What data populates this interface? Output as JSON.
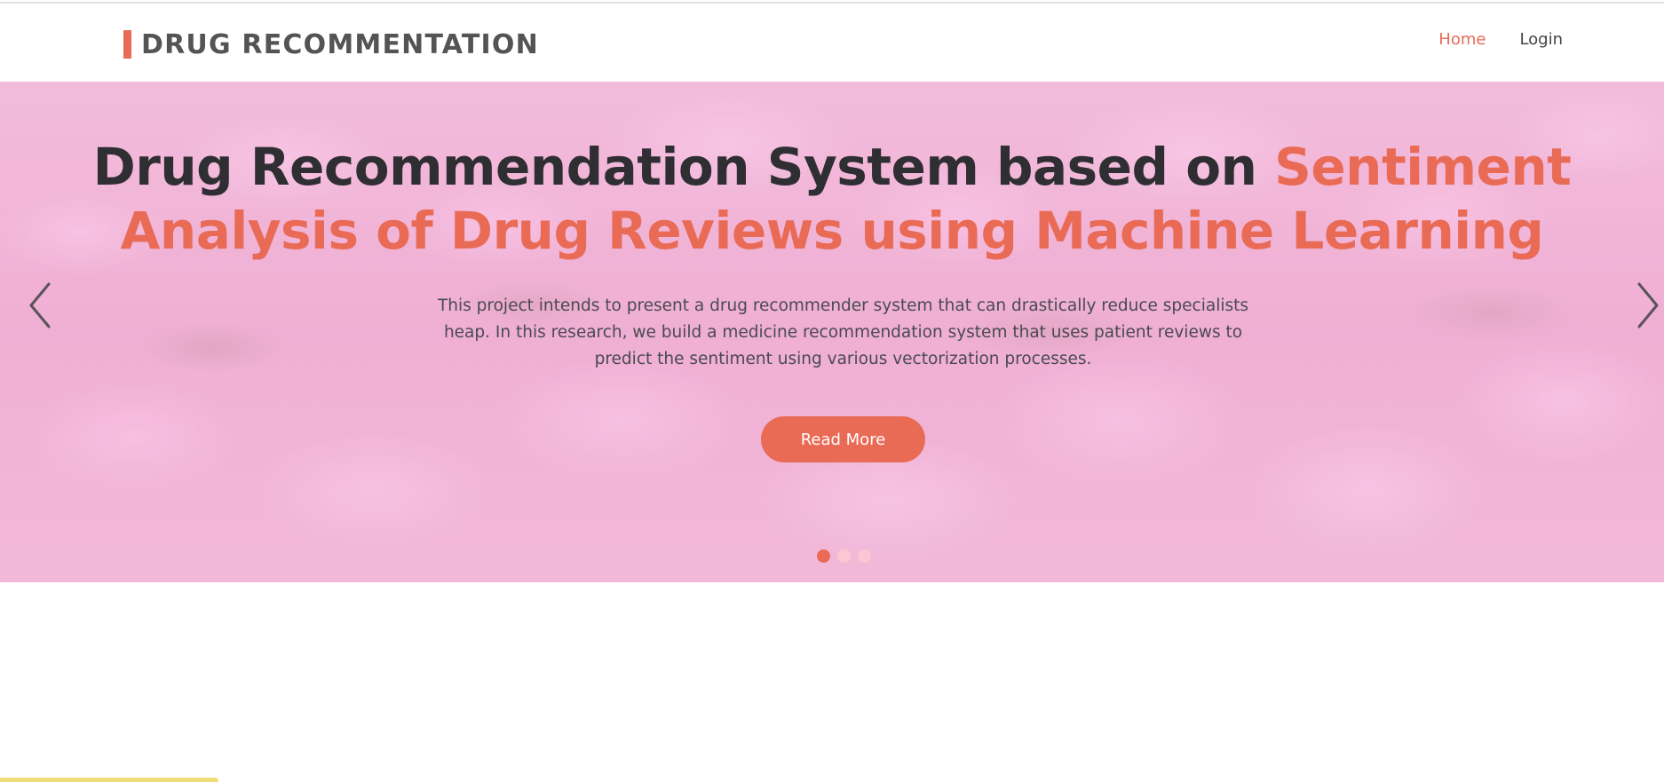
{
  "header": {
    "brand": "DRUG RECOMMENTATION",
    "nav": [
      {
        "label": "Home",
        "active": true
      },
      {
        "label": "Login",
        "active": false
      }
    ]
  },
  "hero": {
    "title_plain": "Drug Recommendation System based on ",
    "title_accent": "Sentiment Analysis of Drug Reviews using Machine Learning",
    "description": "This project intends to present a drug recommender system that can drastically reduce specialists heap. In this research, we build a medicine recommendation system that uses patient reviews to predict the sentiment using various vectorization processes.",
    "button_label": "Read More",
    "prev_icon": "chevron-left-icon",
    "next_icon": "chevron-right-icon",
    "slides": 3,
    "active_slide": 1
  },
  "colors": {
    "accent": "#e96b56",
    "title_dark": "#2f2f33",
    "brand_text": "#545454",
    "hero_tint": "#efa9d0"
  }
}
